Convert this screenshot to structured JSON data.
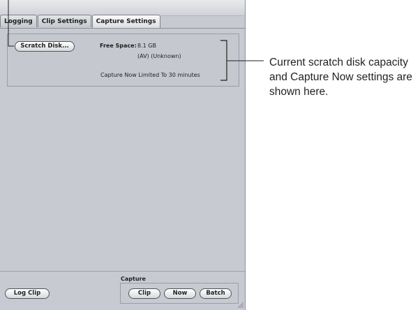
{
  "tabs": [
    {
      "label": "Logging"
    },
    {
      "label": "Clip Settings"
    },
    {
      "label": "Capture Settings"
    }
  ],
  "capture_settings": {
    "scratch_disk_button": "Scratch Disk...",
    "free_space_label": "Free Space:",
    "free_space_value": "8.1 GB",
    "free_space_detail": "(AV) (Unknown)",
    "capture_limit_text": "Capture Now Limited To 30 minutes"
  },
  "bottom": {
    "log_clip_button": "Log Clip",
    "capture_label": "Capture",
    "clip_button": "Clip",
    "now_button": "Now",
    "batch_button": "Batch"
  },
  "callout": {
    "text": "Current scratch disk capacity and Capture Now settings are shown here."
  },
  "colors": {
    "panel_background": "#c7cad1",
    "callout_line": "#231f20"
  }
}
